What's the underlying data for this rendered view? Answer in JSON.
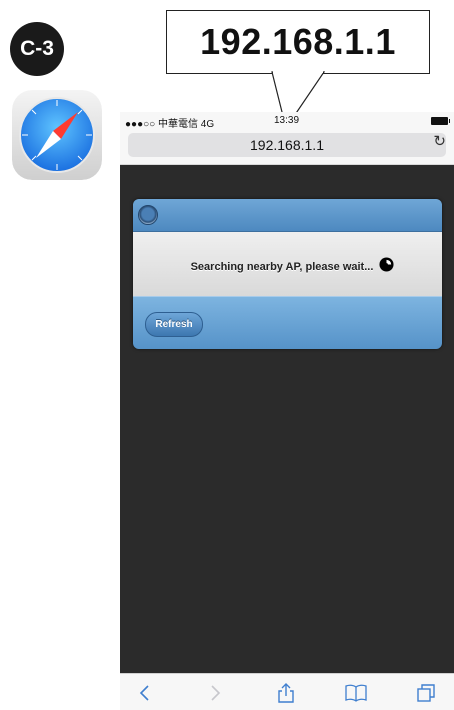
{
  "step_badge": {
    "label": "C-3"
  },
  "callout": {
    "text": "192.168.1.1"
  },
  "status_bar": {
    "carrier": "●●●○○ 中華電信  4G",
    "time": "13:39"
  },
  "address_bar": {
    "url": "192.168.1.1"
  },
  "dialog": {
    "message": "Searching nearby AP, please wait...",
    "refresh_label": "Refresh"
  },
  "icons": {
    "app": "safari-compass-icon",
    "reload": "reload-icon",
    "back": "back-arrow-icon",
    "forward": "forward-arrow-icon",
    "share": "share-icon",
    "bookmarks": "bookmarks-icon",
    "tabs": "tabs-icon",
    "spinner": "loading-spinner-icon"
  },
  "colors": {
    "accent": "#3f7fcf",
    "dialog_header": "#5a93c8",
    "page_bg": "#2b2b2b"
  }
}
